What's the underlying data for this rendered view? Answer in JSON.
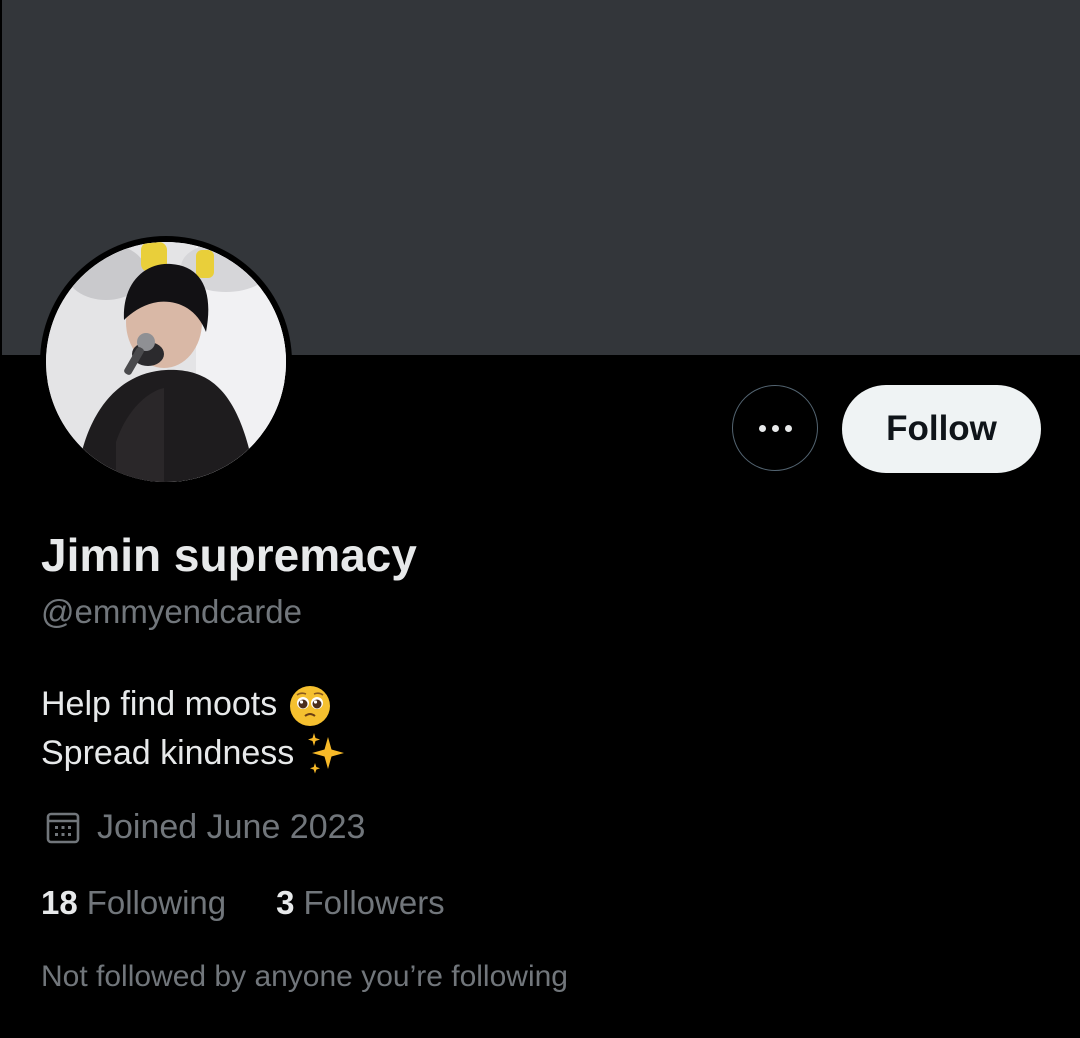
{
  "profile": {
    "display_name": "Jimin supremacy",
    "handle": "@emmyendcarde",
    "bio_line_1": "Help find moots",
    "bio_line_1_emoji": "pleading-face-emoji",
    "bio_line_2": "Spread kindness",
    "bio_line_2_emoji": "sparkles-emoji",
    "joined": "Joined June 2023",
    "following_count": "18",
    "following_label": "Following",
    "followers_count": "3",
    "followers_label": "Followers",
    "followed_by_note": "Not followed by anyone you’re following"
  },
  "actions": {
    "more_icon": "more-horizontal-icon",
    "follow_label": "Follow"
  },
  "colors": {
    "background": "#000000",
    "banner": "#33363a",
    "primary_text": "#e7e9ea",
    "secondary_text": "#71767b",
    "follow_button_bg": "#eff3f4",
    "follow_button_text": "#0f1419",
    "outline_border": "#536471"
  }
}
